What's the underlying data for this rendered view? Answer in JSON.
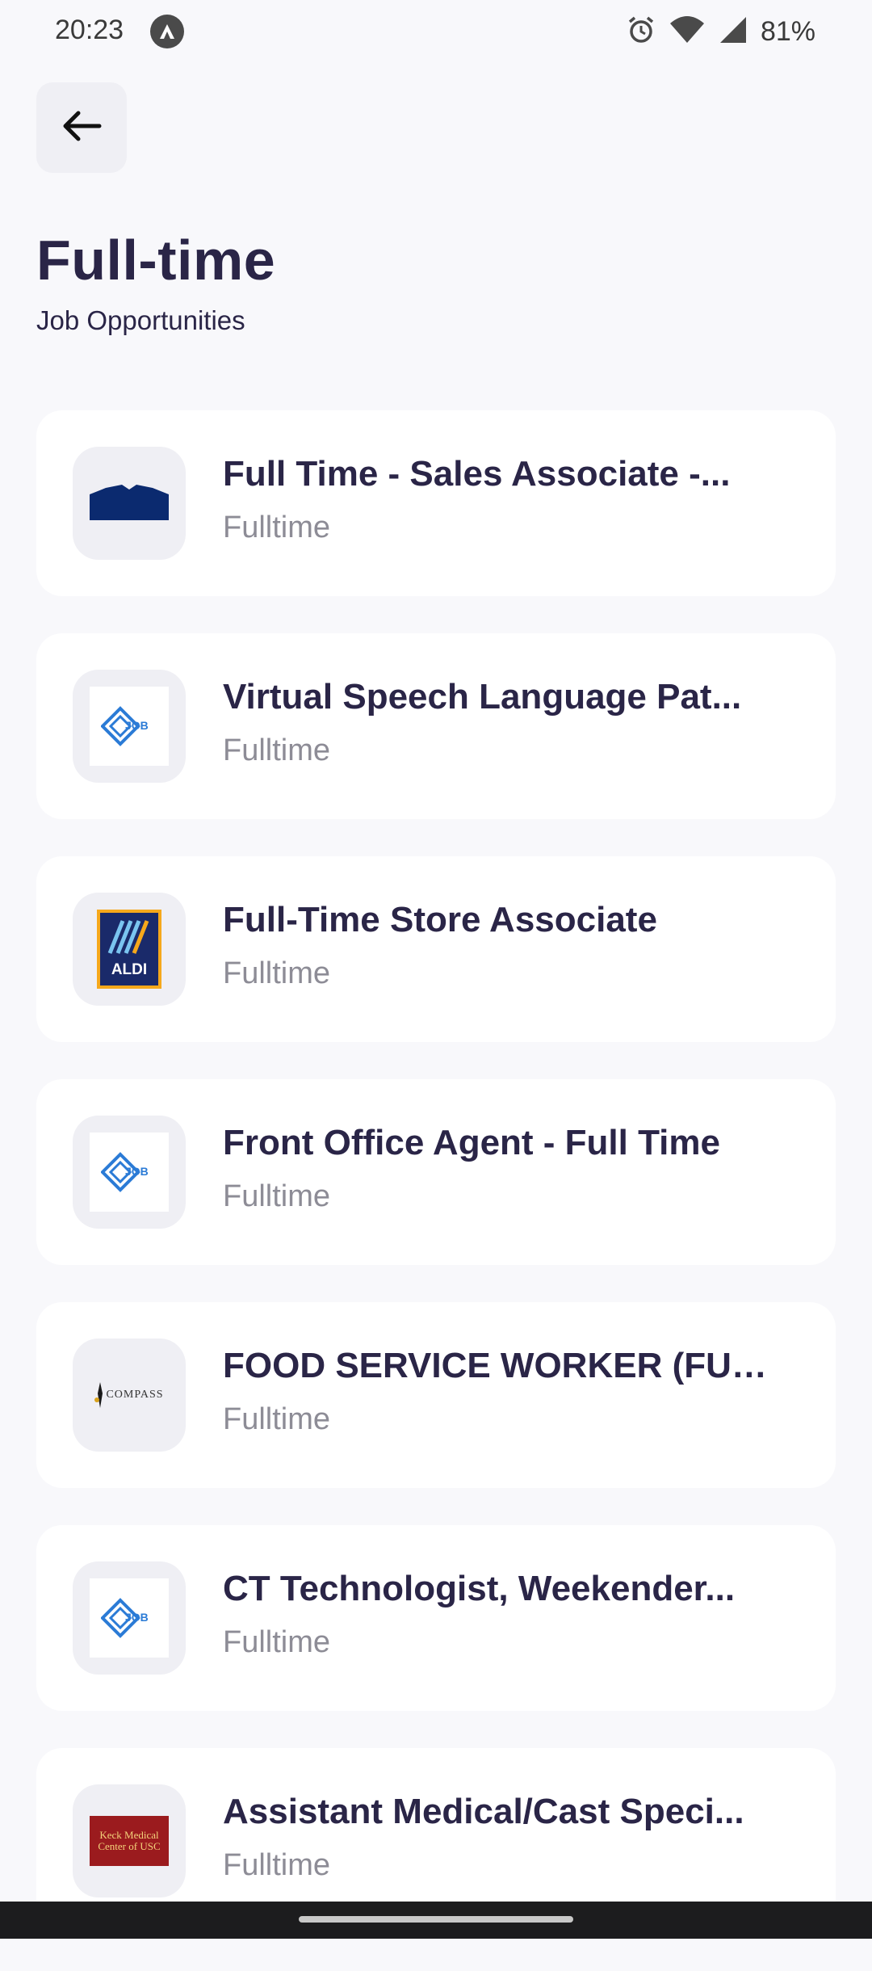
{
  "status_bar": {
    "time": "20:23",
    "app_icon": "app-a-icon",
    "icons": [
      "alarm-icon",
      "wifi-icon",
      "signal-icon"
    ],
    "battery": "81%"
  },
  "header": {
    "back_icon": "arrow-left-icon",
    "title": "Full-time",
    "subtitle": "Job Opportunities"
  },
  "jobs": [
    {
      "title": "Full Time - Sales Associate -...",
      "type": "Fulltime",
      "logo": "tent-logo"
    },
    {
      "title": "Virtual Speech Language Pat...",
      "type": "Fulltime",
      "logo": "job-logo",
      "logo_text": "JOB"
    },
    {
      "title": "Full-Time Store Associate",
      "type": "Fulltime",
      "logo": "aldi-logo",
      "logo_text": "ALDI"
    },
    {
      "title": "Front Office Agent - Full Time",
      "type": "Fulltime",
      "logo": "job-logo",
      "logo_text": "JOB"
    },
    {
      "title": "FOOD SERVICE WORKER (FUL...",
      "type": "Fulltime",
      "logo": "compass-logo",
      "logo_text": "COMPASS"
    },
    {
      "title": "CT Technologist, Weekender...",
      "type": "Fulltime",
      "logo": "job-logo",
      "logo_text": "JOB"
    },
    {
      "title": "Assistant Medical/Cast Speci...",
      "type": "Fulltime",
      "logo": "keck-logo",
      "logo_text": "Keck Medical Center of USC"
    }
  ],
  "colors": {
    "background": "#f8f8fb",
    "card": "#ffffff",
    "title_text": "#2a2547",
    "secondary_text": "#8d8c96",
    "logo_bg": "#efeff4"
  }
}
